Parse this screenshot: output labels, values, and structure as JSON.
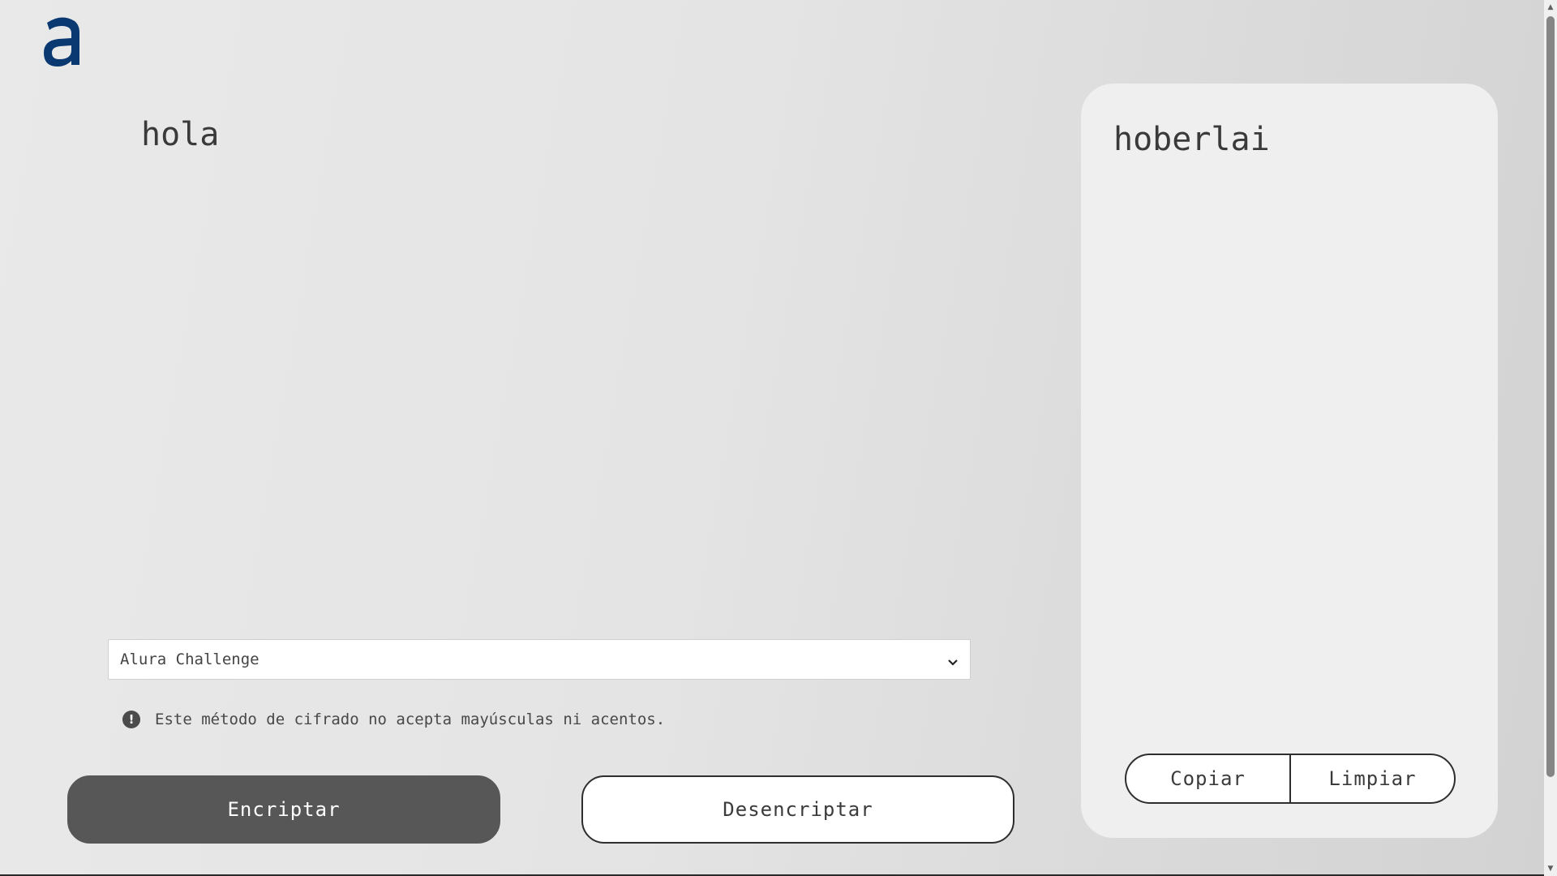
{
  "logo": {
    "icon": "alura-a-logo-icon",
    "color": "#0a3871"
  },
  "input": {
    "value": "hola"
  },
  "method_select": {
    "selected": "Alura Challenge"
  },
  "warning": {
    "text": "Este método de cifrado no acepta mayúsculas ni acentos.",
    "icon": "exclamation-circle-icon"
  },
  "buttons": {
    "encrypt_label": "Encriptar",
    "decrypt_label": "Desencriptar"
  },
  "output": {
    "text": "hoberlai",
    "copy_label": "Copiar",
    "clear_label": "Limpiar"
  },
  "colors": {
    "primary_button": "#575757",
    "panel_bg": "#efefef",
    "logo_blue": "#0a3871"
  }
}
